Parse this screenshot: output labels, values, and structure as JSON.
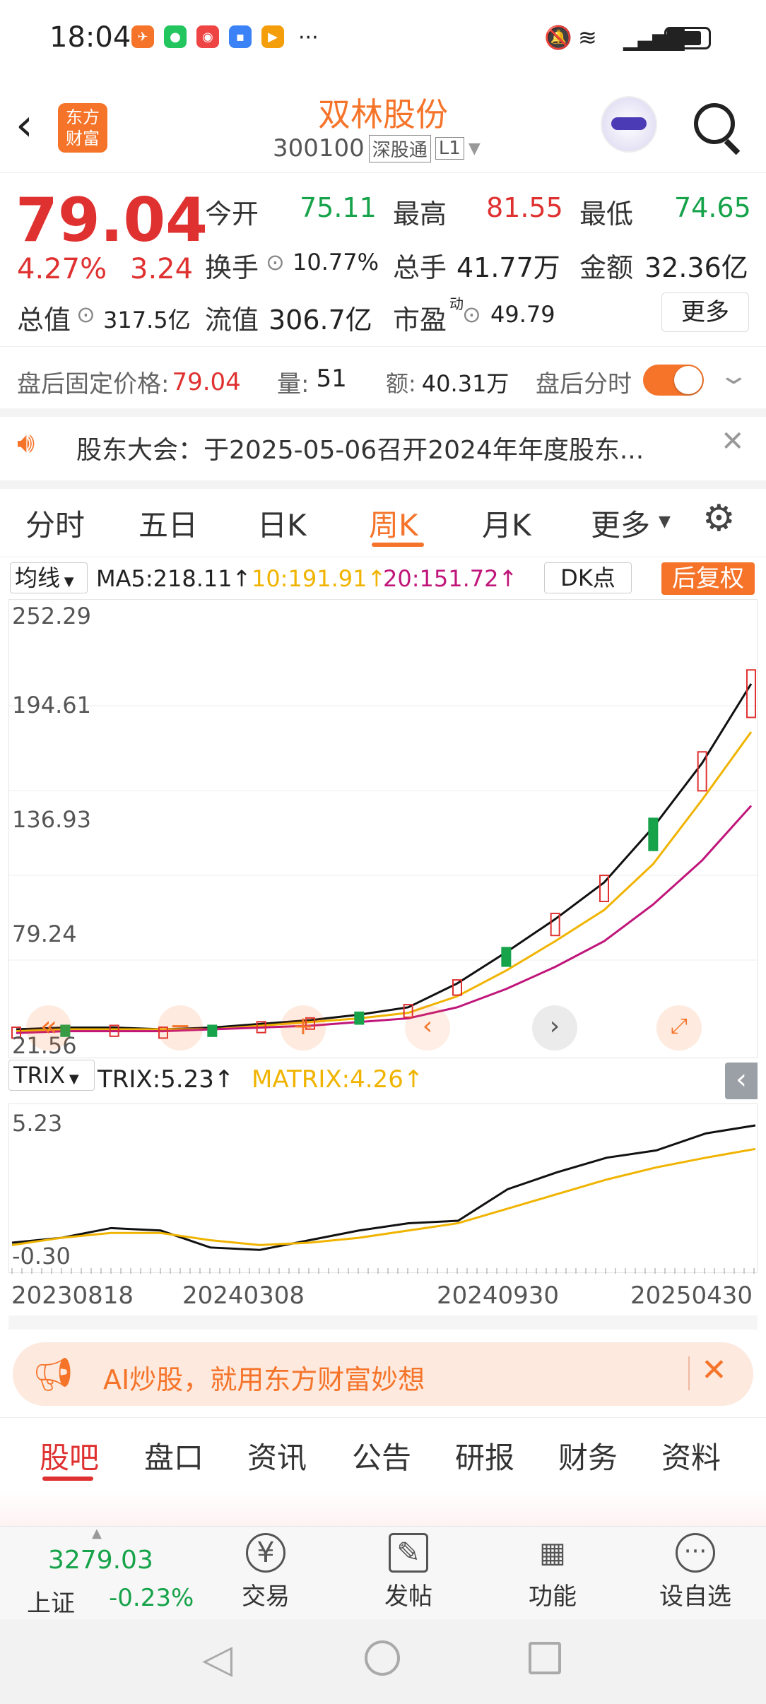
{
  "status_bar": {
    "time": "18:04",
    "more": "···"
  },
  "header": {
    "logo": "东方\n财富",
    "stock_name": "双林股份",
    "stock_code": "300100",
    "badge_connect": "深股通",
    "badge_level": "L1"
  },
  "quote": {
    "price": "79.04",
    "change_pct": "4.27%",
    "change_abs": "3.24",
    "open_label": "今开",
    "open": "75.11",
    "high_label": "最高",
    "high": "81.55",
    "low_label": "最低",
    "low": "74.65",
    "turnover_label": "换手",
    "turnover": "10.77%",
    "volume_label": "总手",
    "volume": "41.77万",
    "amount_label": "金额",
    "amount": "32.36亿",
    "mcap_label": "总值",
    "mcap": "317.5亿",
    "float_label": "流值",
    "float_value": "306.7亿",
    "pe_label": "市盈",
    "pe_sup": "动",
    "pe": "49.79",
    "more_button": "更多"
  },
  "after_hours": {
    "label": "盘后固定价格:",
    "price": "79.04",
    "vol_label": "量:",
    "vol": "51",
    "amt_label": "额:",
    "amt": "40.31万",
    "toggle_label": "盘后分时"
  },
  "notice": {
    "text": "股东大会：于2025-05-06召开2024年年度股东..."
  },
  "tabs": [
    "分时",
    "五日",
    "日K",
    "周K",
    "月K",
    "更多"
  ],
  "active_tab": "周K",
  "ma_bar": {
    "selector": "均线",
    "ma5": "MA5:218.11↑",
    "ma10": "10:191.91↑",
    "ma20": "20:151.72↑",
    "dk": "DK点",
    "adjust": "后复权"
  },
  "chart_labels": {
    "y1": "252.29",
    "y2": "194.61",
    "y3": "136.93",
    "y4": "79.24",
    "y5": "21.56"
  },
  "trix_bar": {
    "selector": "TRIX",
    "trix": "TRIX:5.23↑",
    "matrix": "MATRIX:4.26↑",
    "y_top": "5.23",
    "y_bottom": "-0.30"
  },
  "dates": [
    "20230818",
    "20240308",
    "20240930",
    "20250430"
  ],
  "colors": {
    "accent": "#f5742a",
    "up": "#e03131",
    "down": "#16a34a",
    "ma5": "#111111",
    "ma10": "#f0b400",
    "ma20": "#c0157a"
  },
  "ad": {
    "text": "AI炒股，就用东方财富妙想"
  },
  "bottom_tabs": [
    "股吧",
    "盘口",
    "资讯",
    "公告",
    "研报",
    "财务",
    "资料"
  ],
  "bottom_active": "股吧",
  "index_box": {
    "value": "3279.03",
    "name": "上证",
    "pct": "-0.23%"
  },
  "nav": [
    {
      "label": "交易",
      "icon": "yuan-exchange-icon"
    },
    {
      "label": "发帖",
      "icon": "edit-icon"
    },
    {
      "label": "功能",
      "icon": "grid-icon"
    },
    {
      "label": "设自选",
      "icon": "more-circle-icon"
    }
  ],
  "chart_data": {
    "type": "line",
    "title": "",
    "ylim": [
      21.56,
      252.29
    ],
    "series": [
      {
        "name": "MA5",
        "values": [
          30,
          31,
          31,
          30,
          31,
          33,
          35,
          38,
          42,
          55,
          72,
          90,
          110,
          140,
          175,
          218.11
        ]
      },
      {
        "name": "10",
        "values": [
          29,
          30,
          30,
          30,
          30,
          32,
          34,
          36,
          39,
          48,
          62,
          78,
          95,
          120,
          155,
          191.91
        ]
      },
      {
        "name": "20",
        "values": [
          28,
          29,
          29,
          29,
          30,
          31,
          32,
          34,
          36,
          42,
          52,
          64,
          78,
          98,
          122,
          151.72
        ]
      }
    ]
  }
}
